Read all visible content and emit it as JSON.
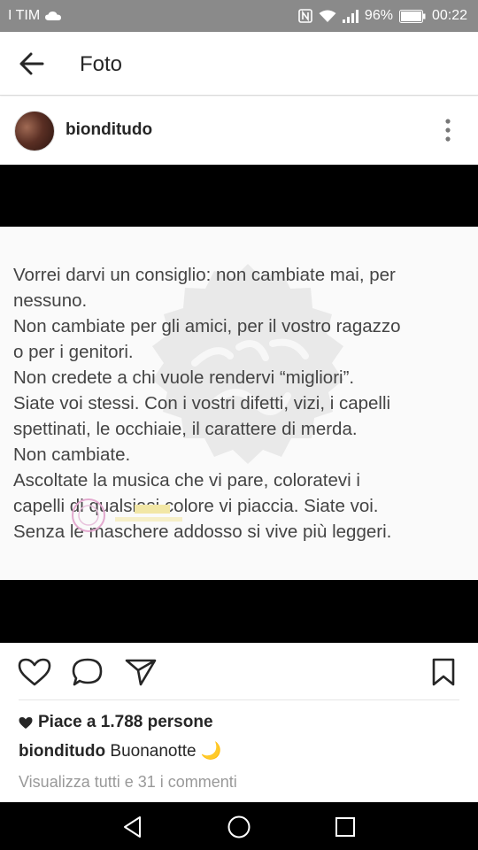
{
  "status_bar": {
    "carrier": "I TIM",
    "battery": "96%",
    "time": "00:22"
  },
  "app_bar": {
    "title": "Foto"
  },
  "post": {
    "username": "bionditudo",
    "photo_text": "Vorrei darvi un consiglio: non cambiate mai, per\nnessuno.\nNon cambiate per gli amici, per il vostro ragazzo\no per i genitori.\nNon credete a chi vuole rendervi “migliori”.\nSiate voi stessi. Con i vostri difetti, vizi, i capelli\nspettinati, le occhiaie, il carattere di merda.\nNon cambiate.\nAscoltate la musica che vi pare, coloratevi i\ncapelli di qualsiasi colore vi piaccia. Siate voi.\nSenza le maschere addosso si vive più leggeri.",
    "likes": "Piace a 1.788 persone",
    "caption_user": "bionditudo",
    "caption_text": "Buonanotte 🌙",
    "view_comments": "Visualizza tutti e 31 i commenti"
  },
  "icons": [
    "arrow-left-icon",
    "more-vertical-icon",
    "heart-icon",
    "comment-icon",
    "send-icon",
    "bookmark-icon",
    "heart-filled-icon",
    "nav-back-icon",
    "nav-home-icon",
    "nav-recents-icon"
  ]
}
